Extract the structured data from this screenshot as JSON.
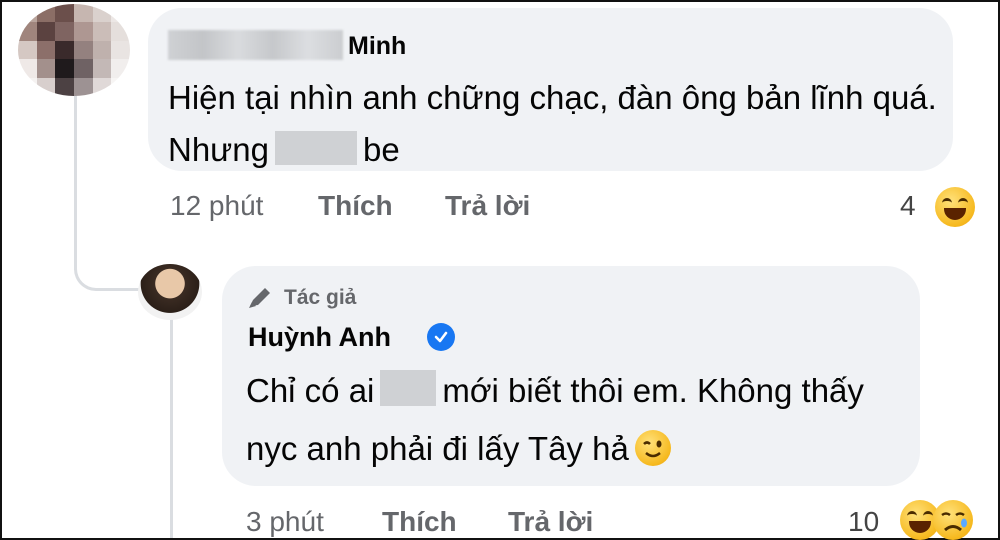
{
  "comment": {
    "author_name": "Minh",
    "text_before_redaction": "Hiện tại nhìn anh chững chạc, đàn ông bản lĩnh quá. Nhưng",
    "text_after_redaction": "be",
    "time": "12 phút",
    "like_label": "Thích",
    "reply_label": "Trả lời",
    "reaction_count": "4",
    "reaction_icon": "laugh-reaction-icon"
  },
  "reply": {
    "author_badge_icon": "pen-icon",
    "author_badge_label": "Tác giả",
    "author_name": "Huỳnh Anh",
    "verified_icon": "verified-badge-icon",
    "text_before_redaction": "Chỉ có ai",
    "text_after_redaction": "mới biết thôi em. Không thấy nyc anh phải đi lấy Tây hả",
    "emoji": "winking-face-icon",
    "time": "3 phút",
    "like_label": "Thích",
    "reply_label": "Trả lời",
    "reaction_count": "10",
    "reaction_icons": [
      "laugh-reaction-icon",
      "sad-reaction-icon"
    ]
  },
  "colors": {
    "bubble": "#f0f2f5",
    "meta_text": "#65676b",
    "verified": "#1877f2",
    "redaction": "#cfd1d4"
  }
}
